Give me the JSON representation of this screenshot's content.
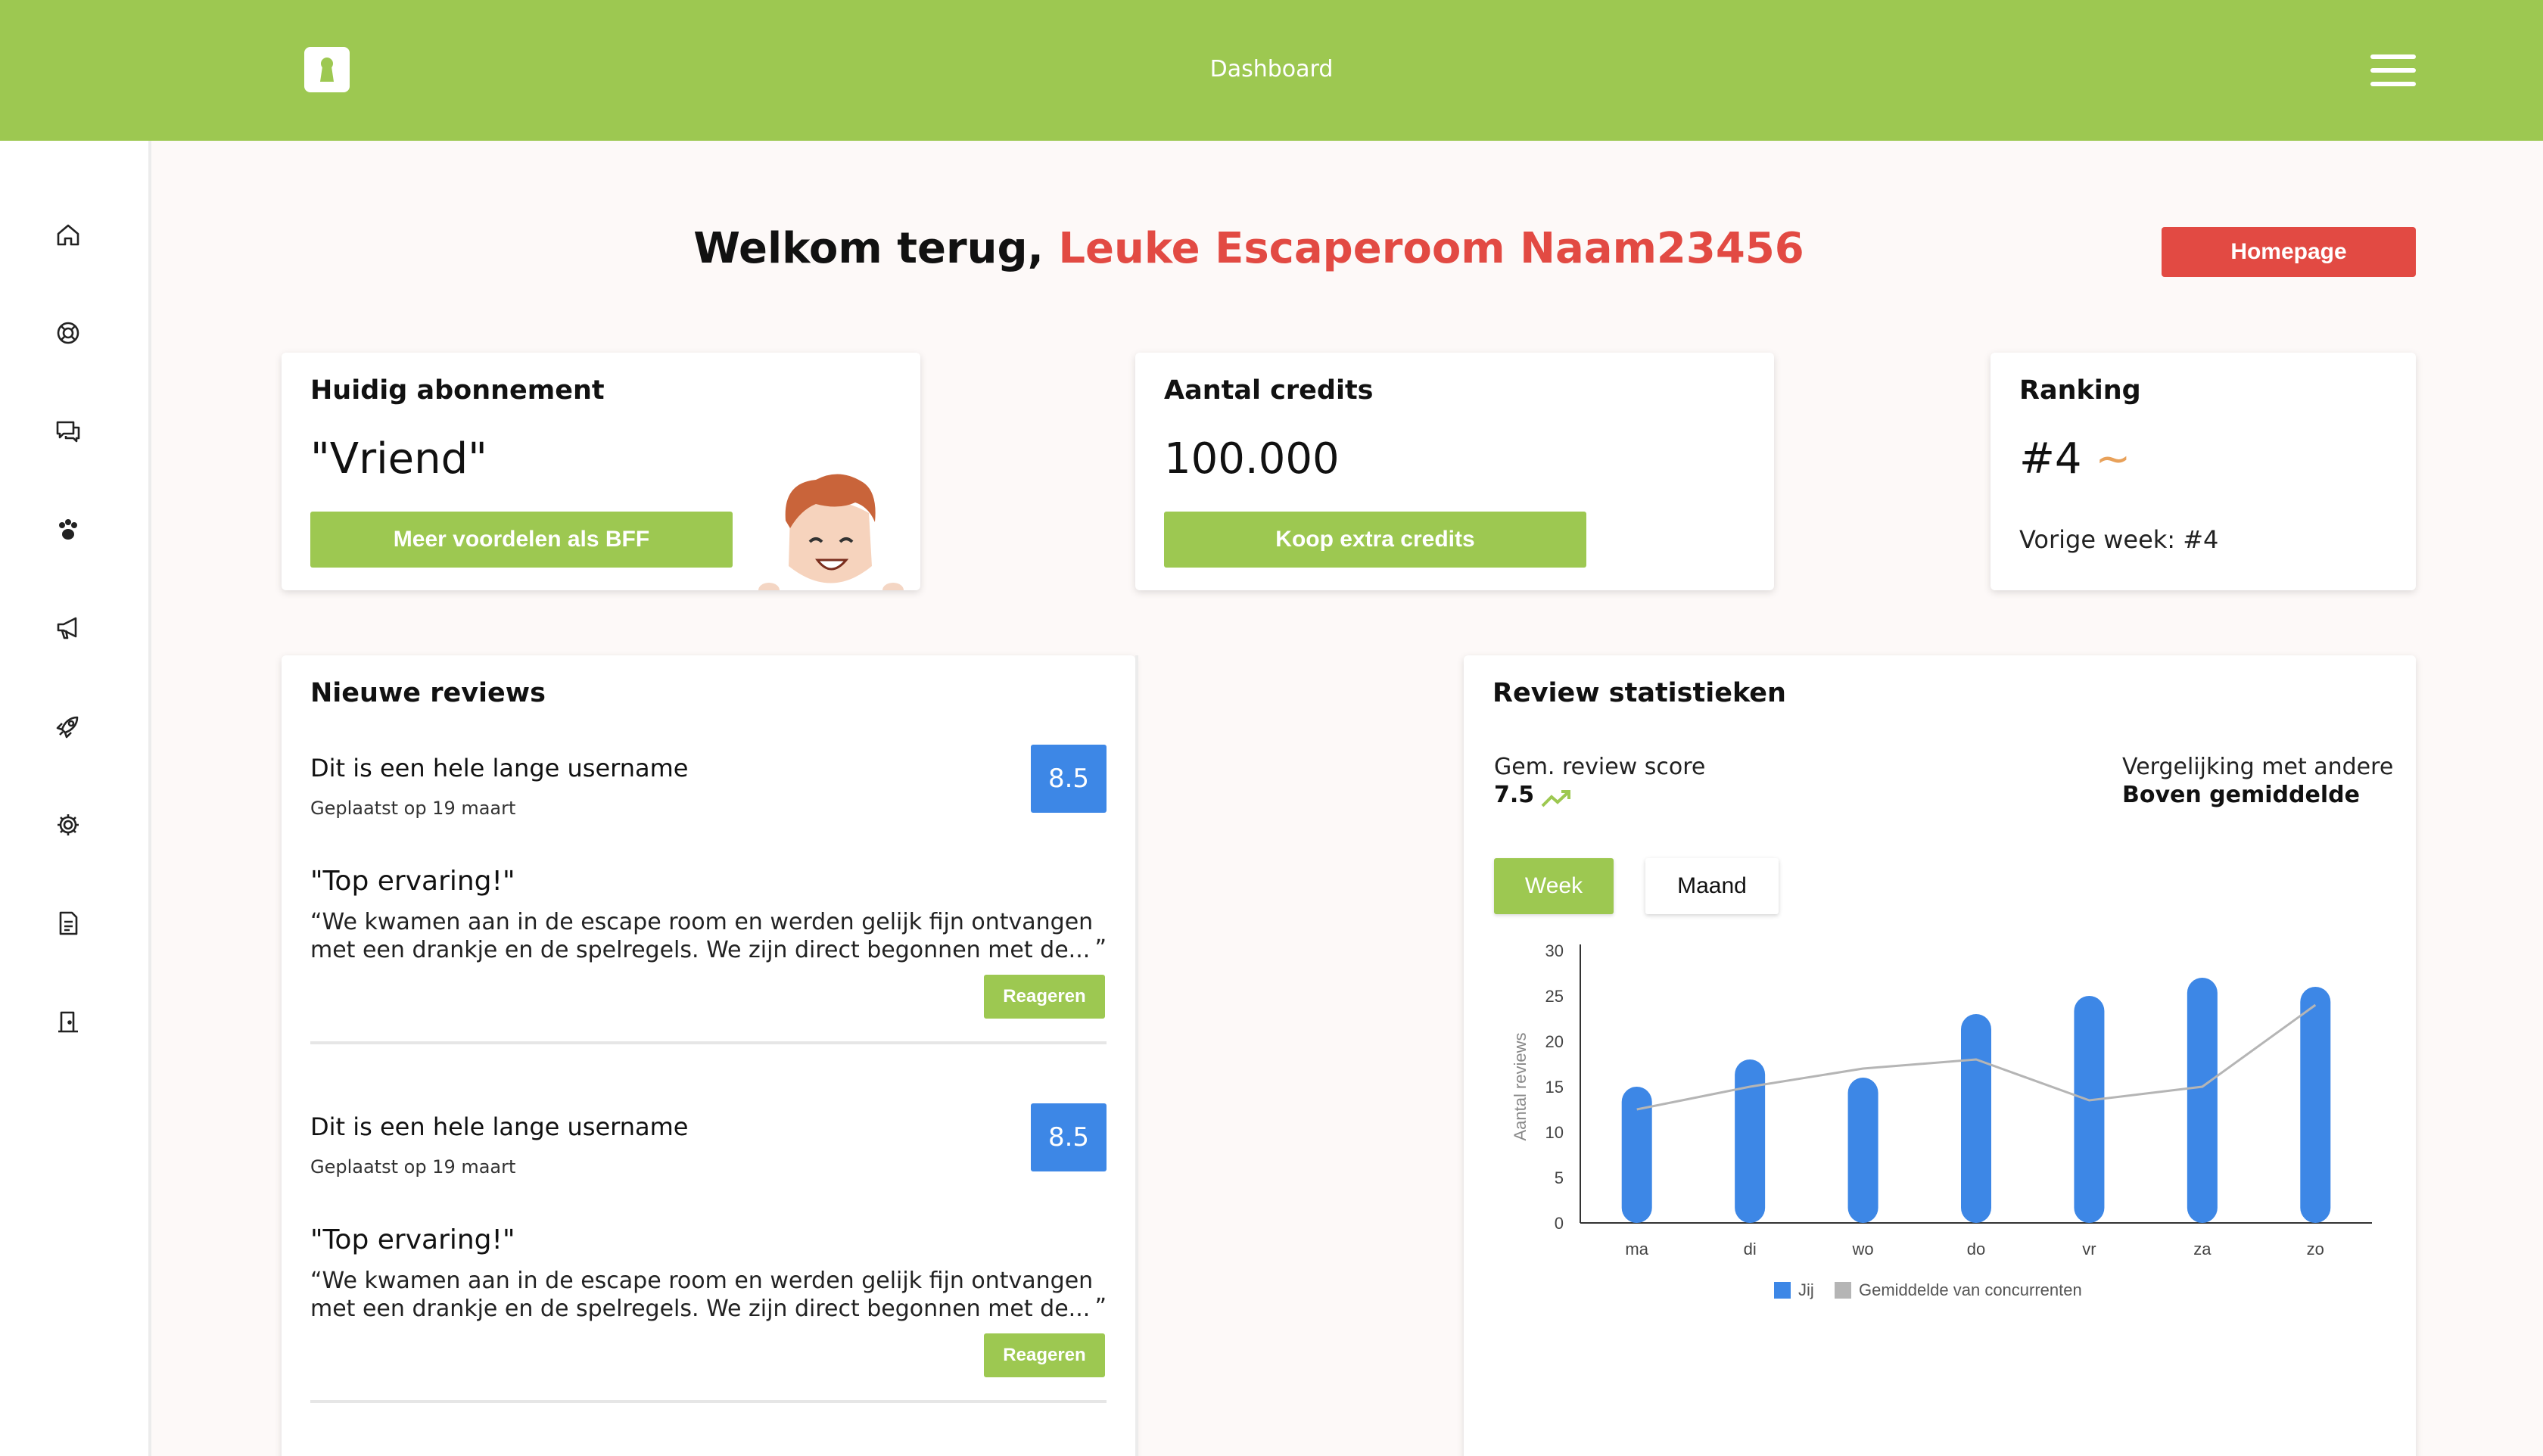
{
  "header": {
    "title": "Dashboard"
  },
  "welcome": {
    "prefix": "Welkom terug, ",
    "name": "Leuke Escaperoom Naam23456"
  },
  "homepage_button": "Homepage",
  "subscription": {
    "title": "Huidig abonnement",
    "value": "\"Vriend\"",
    "button": "Meer voordelen als BFF"
  },
  "credits": {
    "title": "Aantal credits",
    "value": "100.000",
    "button": "Koop extra credits"
  },
  "ranking": {
    "title": "Ranking",
    "value": "#4",
    "trend": "~",
    "previous": "Vorige week: #4"
  },
  "reviews": {
    "title": "Nieuwe reviews",
    "items": [
      {
        "username": "Dit is een hele lange username",
        "date": "Geplaatst op 19 maart",
        "score": "8.5",
        "headline": "\"Top ervaring!\"",
        "text": "“We kwamen aan in de escape room en werden gelijk fijn ontvangen met een drankje en de spelregels. We zijn direct begonnen met de...",
        "close_quote": "”",
        "button": "Reageren"
      },
      {
        "username": "Dit is een hele lange username",
        "date": "Geplaatst op 19 maart",
        "score": "8.5",
        "headline": "\"Top ervaring!\"",
        "text": "“We kwamen aan in de escape room en werden gelijk fijn ontvangen met een drankje en de spelregels. We zijn direct begonnen met de...",
        "close_quote": "”",
        "button": "Reageren"
      }
    ]
  },
  "stats": {
    "title": "Review statistieken",
    "avg_label": "Gem. review score",
    "avg_value": "7.5",
    "compare_label": "Vergelijking met andere",
    "compare_value": "Boven gemiddelde",
    "tabs": {
      "week": "Week",
      "month": "Maand"
    }
  },
  "chart_data": {
    "type": "bar",
    "categories": [
      "ma",
      "di",
      "wo",
      "do",
      "vr",
      "za",
      "zo"
    ],
    "series": [
      {
        "name": "Jij",
        "type": "bar",
        "color": "#3d87e6",
        "values": [
          15,
          18,
          16,
          23,
          25,
          27,
          26
        ]
      },
      {
        "name": "Gemiddelde van concurrenten",
        "type": "line",
        "color": "#b5b5b5",
        "values": [
          12.5,
          15,
          17,
          18,
          13.5,
          15,
          24
        ]
      }
    ],
    "ylabel": "Aantal reviews",
    "ylim": [
      0,
      30
    ],
    "yticks": [
      0,
      5,
      10,
      15,
      20,
      25,
      30
    ],
    "legend_position": "bottom"
  },
  "icons": [
    "home-icon",
    "lifebuoy-icon",
    "chat-icon",
    "paw-icon",
    "megaphone-icon",
    "rocket-icon",
    "gear-icon",
    "document-icon",
    "door-icon"
  ],
  "colors": {
    "brand_green": "#9dc851",
    "accent_red": "#e24a43",
    "score_blue": "#3d87e6",
    "trend_orange": "#e8a15a"
  }
}
